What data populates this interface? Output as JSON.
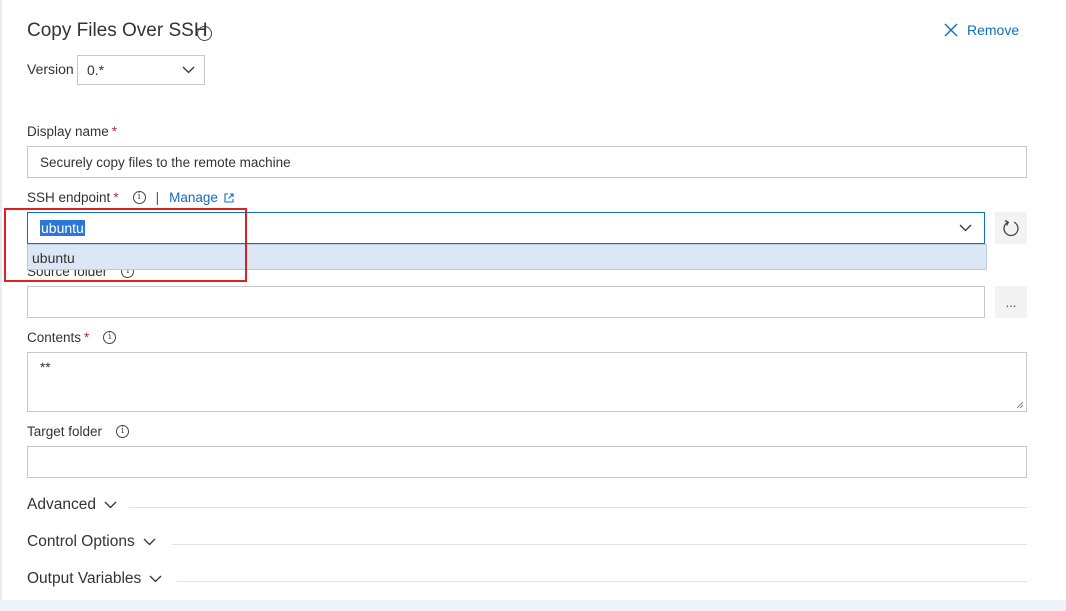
{
  "task": {
    "title": "Copy Files Over SSH",
    "remove_label": "Remove",
    "version_label": "Version",
    "version_value": "0.*"
  },
  "fields": {
    "display_name": {
      "label": "Display name",
      "required_mark": "*",
      "value": "Securely copy files to the remote machine"
    },
    "ssh_endpoint": {
      "label": "SSH endpoint",
      "required_mark": "*",
      "separator": "|",
      "manage_label": "Manage",
      "value": "ubuntu",
      "options": [
        "ubuntu"
      ]
    },
    "source_folder": {
      "label": "Source folder",
      "value": "",
      "browse_label": "..."
    },
    "contents": {
      "label": "Contents",
      "required_mark": "*",
      "value": "**"
    },
    "target_folder": {
      "label": "Target folder",
      "value": ""
    }
  },
  "sections": [
    {
      "label": "Advanced"
    },
    {
      "label": "Control Options"
    },
    {
      "label": "Output Variables"
    }
  ],
  "colors": {
    "link": "#106ebe",
    "required": "#c4262e",
    "highlight": "#e02020",
    "selection": "#2a77d6"
  },
  "icons": [
    "info-icon",
    "close-icon",
    "chevron-down-icon",
    "external-link-icon",
    "refresh-icon",
    "ellipsis-icon"
  ]
}
